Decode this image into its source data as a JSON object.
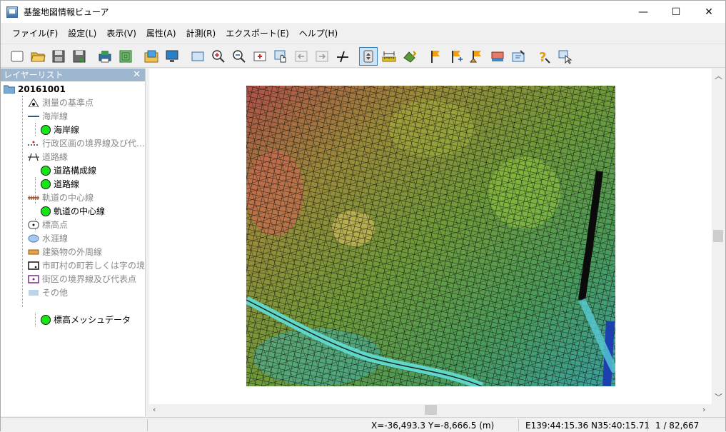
{
  "window": {
    "title": "基盤地図情報ビューア",
    "controls": {
      "minimize": "—",
      "maximize": "☐",
      "close": "✕"
    }
  },
  "menu": [
    "ファイル(F)",
    "設定(L)",
    "表示(V)",
    "属性(A)",
    "計測(R)",
    "エクスポート(E)",
    "ヘルプ(H)"
  ],
  "toolbar": {
    "buttons": [
      "new-icon",
      "open-folder-icon",
      "save-icon",
      "save-as-icon",
      "print-icon",
      "layers-icon",
      "open-image-icon",
      "monitor-icon",
      "full-extent-icon",
      "zoom-in-icon",
      "zoom-out-icon",
      "zoom-center-icon",
      "pan-hand-icon",
      "back-icon",
      "forward-icon",
      "draw-line-icon",
      "select-icon",
      "measure-ruler-icon",
      "paint-icon",
      "flag-icon",
      "flag-add-icon",
      "flag-edit-icon",
      "flag-delete-icon",
      "layer-settings-icon",
      "help-icon",
      "info-cursor-icon"
    ],
    "active": "select-icon"
  },
  "layer_panel": {
    "title": "レイヤーリスト",
    "close": "✕",
    "root": "20161001",
    "items": [
      {
        "label": "測量の基準点",
        "indent": 1,
        "icon": "survey-point-icon",
        "grey": true
      },
      {
        "label": "海岸線",
        "indent": 1,
        "icon": "coastline-icon",
        "grey": true
      },
      {
        "label": "海岸線",
        "indent": 2,
        "icon": "green-dot",
        "grey": false
      },
      {
        "label": "行政区画の境界線及び代…",
        "indent": 1,
        "icon": "admin-boundary-icon",
        "grey": true
      },
      {
        "label": "道路縁",
        "indent": 1,
        "icon": "road-icon",
        "grey": true
      },
      {
        "label": "道路構成線",
        "indent": 2,
        "icon": "green-dot",
        "grey": false
      },
      {
        "label": "道路線",
        "indent": 2,
        "icon": "green-dot",
        "grey": false
      },
      {
        "label": "軌道の中心線",
        "indent": 1,
        "icon": "railway-icon",
        "grey": true
      },
      {
        "label": "軌道の中心線",
        "indent": 2,
        "icon": "green-dot",
        "grey": false
      },
      {
        "label": "標高点",
        "indent": 1,
        "icon": "elevation-point-icon",
        "grey": true
      },
      {
        "label": "水涯線",
        "indent": 1,
        "icon": "waterline-icon",
        "grey": true
      },
      {
        "label": "建築物の外周線",
        "indent": 1,
        "icon": "building-icon",
        "grey": true
      },
      {
        "label": "市町村の町若しくは字の境…",
        "indent": 1,
        "icon": "town-boundary-icon",
        "grey": true
      },
      {
        "label": "街区の境界線及び代表点",
        "indent": 1,
        "icon": "block-boundary-icon",
        "grey": true
      },
      {
        "label": "その他",
        "indent": 1,
        "icon": "other-icon",
        "grey": true
      },
      {
        "label": "標高メッシュデータ",
        "indent": 2,
        "icon": "green-dot",
        "grey": false
      }
    ]
  },
  "status": {
    "xy": "X=-36,493.3 Y=-8,666.5 (m)",
    "latlon": "E139:44:15.36 N35:40:15.71",
    "scale": "1 / 82,667"
  },
  "colors": {
    "accent": "#3c7fb1",
    "panel_header": "#9fb6cf",
    "layer_on": "#13e813"
  }
}
